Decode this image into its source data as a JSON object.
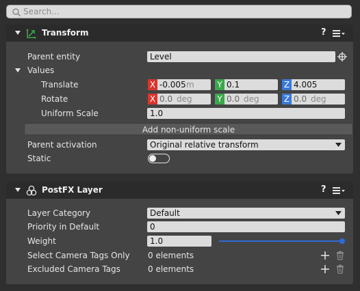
{
  "search": {
    "placeholder": "Search..."
  },
  "transform": {
    "title": "Transform",
    "help": "?",
    "parent_entity_label": "Parent entity",
    "parent_entity_value": "Level",
    "values_label": "Values",
    "translate_label": "Translate",
    "translate": {
      "x": "-0.005",
      "y": "0.1",
      "z": "4.005",
      "unit": "m"
    },
    "rotate_label": "Rotate",
    "rotate": {
      "x": "0.0",
      "y": "0.0",
      "z": "0.0",
      "unit": "deg"
    },
    "uniform_scale_label": "Uniform Scale",
    "uniform_scale_value": "1.0",
    "add_non_uniform_label": "Add non-uniform scale",
    "parent_activation_label": "Parent activation",
    "parent_activation_value": "Original relative transform",
    "static_label": "Static",
    "static_on": false
  },
  "postfx": {
    "title": "PostFX Layer",
    "help": "?",
    "layer_category_label": "Layer Category",
    "layer_category_value": "Default",
    "priority_label": "Priority in Default",
    "priority_value": "0",
    "weight_label": "Weight",
    "weight_value": "1.0",
    "weight_fraction": 1.0,
    "select_tags_label": "Select Camera Tags Only",
    "select_tags_value": "0 elements",
    "excluded_tags_label": "Excluded Camera Tags",
    "excluded_tags_value": "0 elements"
  },
  "axis_labels": {
    "x": "X",
    "y": "Y",
    "z": "Z"
  },
  "colors": {
    "axis_x": "#d7352f",
    "axis_y": "#3aa84a",
    "axis_z": "#3a78d8",
    "accent": "#2f6bd6"
  },
  "icons": [
    "search-icon",
    "transform-icon",
    "postfx-icon",
    "menu-icon",
    "target-icon",
    "plus-icon",
    "trash-icon",
    "chevron-down-icon"
  ]
}
